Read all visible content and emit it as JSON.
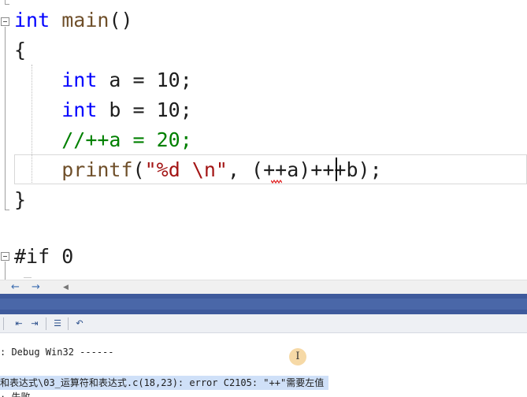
{
  "editor": {
    "lines": [
      {
        "id": "main-sig",
        "parts": [
          {
            "t": "kw",
            "v": "int"
          },
          {
            "t": "",
            "v": " "
          },
          {
            "t": "ty",
            "v": "main"
          },
          {
            "t": "",
            "v": "()"
          }
        ]
      },
      {
        "id": "open-brace",
        "parts": [
          {
            "t": "",
            "v": "{"
          }
        ]
      },
      {
        "id": "decl-a",
        "parts": [
          {
            "t": "",
            "v": "    "
          },
          {
            "t": "kw",
            "v": "int"
          },
          {
            "t": "",
            "v": " a = 10;"
          }
        ]
      },
      {
        "id": "decl-b",
        "parts": [
          {
            "t": "",
            "v": "    "
          },
          {
            "t": "kw",
            "v": "int"
          },
          {
            "t": "",
            "v": " b = 10;"
          }
        ]
      },
      {
        "id": "comment",
        "parts": [
          {
            "t": "",
            "v": "    "
          },
          {
            "t": "cm",
            "v": "//++a = 20;"
          }
        ]
      },
      {
        "id": "printf",
        "parts": [
          {
            "t": "",
            "v": "    "
          },
          {
            "t": "ty",
            "v": "printf"
          },
          {
            "t": "",
            "v": "("
          },
          {
            "t": "st",
            "v": "\"%d \\n\""
          },
          {
            "t": "",
            "v": ", (++a)+++b);"
          }
        ]
      },
      {
        "id": "close-brace",
        "parts": [
          {
            "t": "",
            "v": "}"
          }
        ]
      },
      {
        "id": "blank",
        "parts": [
          {
            "t": "",
            "v": ""
          }
        ]
      },
      {
        "id": "if0",
        "parts": [
          {
            "t": "",
            "v": "#if 0"
          }
        ]
      }
    ]
  },
  "output": {
    "lines": [
      {
        "text": ": Debug Win32 ------",
        "selected": false
      },
      {
        "text": "和表达式\\03_运算符和表达式.c(18,23): error C2105: \"++\"需要左值",
        "selected": true
      },
      {
        "text": "· 失败",
        "selected": false
      }
    ]
  },
  "cursor_badge": "I"
}
